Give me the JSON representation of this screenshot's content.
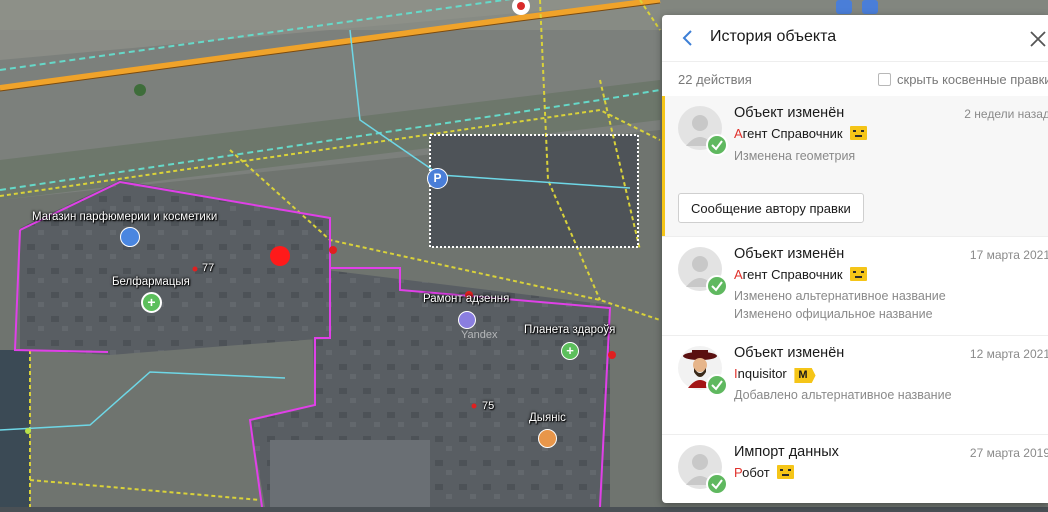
{
  "map": {
    "pois": [
      {
        "name": "shop-cosmetics",
        "label": "Магазин парфюмерии и косметики"
      },
      {
        "name": "pharmacy-belfarmatsyya",
        "label": "Белфармацыя"
      },
      {
        "name": "house-number-77",
        "label": "77"
      },
      {
        "name": "repair-shop",
        "label": "Рамонт адзення"
      },
      {
        "name": "pharmacy-planeta",
        "label": "Планета здароўя"
      },
      {
        "name": "house-number-75",
        "label": "75"
      },
      {
        "name": "shop-dyyanis",
        "label": "Дыяніс"
      }
    ],
    "parking_glyph": "P",
    "watermark": "Yandex"
  },
  "panel": {
    "title": "История объекта",
    "count": "22 действия",
    "hide_indirect_label": "скрыть косвенные правки",
    "message_button": "Сообщение автору правки",
    "entries": [
      {
        "title": "Объект изменён",
        "date": "2 недели назад",
        "author_first": "А",
        "author_rest": "гент Справочник",
        "badge": "robot",
        "changes": [
          "Изменена геометрия"
        ]
      },
      {
        "title": "Объект изменён",
        "date": "17 марта 2021",
        "author_first": "А",
        "author_rest": "гент Справочник",
        "badge": "robot",
        "changes": [
          "Изменено альтернативное название",
          "Изменено официальное название"
        ]
      },
      {
        "title": "Объект изменён",
        "date": "12 марта 2021",
        "author_first": "I",
        "author_rest": "nquisitor",
        "badge": "M",
        "changes": [
          "Добавлено альтернативное название"
        ]
      },
      {
        "title": "Импорт данных",
        "date": "27 марта 2019",
        "author_first": "Р",
        "author_rest": "обот",
        "badge": "robot",
        "changes": []
      }
    ]
  },
  "colors": {
    "accent_yellow": "#f5c518",
    "status_green": "#5fb85f",
    "author_red": "#e0312b",
    "back_blue": "#3d7fd6",
    "selection_magenta": "#e040e8"
  }
}
